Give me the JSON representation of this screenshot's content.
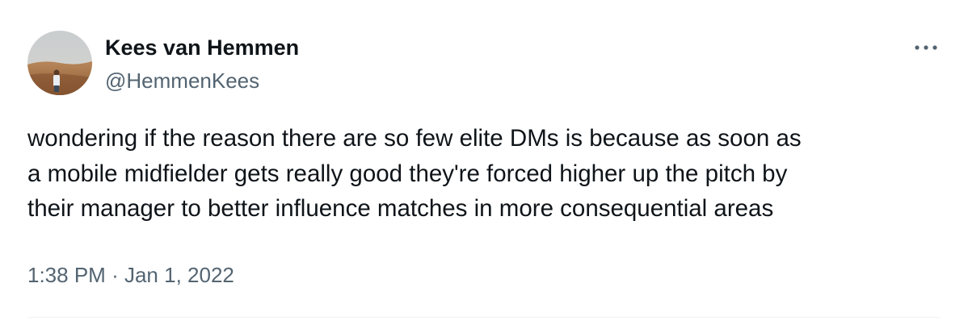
{
  "tweet": {
    "author": {
      "display_name": "Kees van Hemmen",
      "handle": "@HemmenKees"
    },
    "more_icon": "more-horizontal-icon",
    "text": "wondering if the reason there are so few elite DMs is because as soon as\na mobile midfielder gets really good they're forced higher up the pitch by\ntheir manager to better influence matches in more consequential areas",
    "time": "1:38 PM",
    "separator": "·",
    "date": "Jan 1, 2022"
  },
  "colors": {
    "primary_text": "#0f1419",
    "secondary_text": "#536471",
    "divider": "#eff3f4"
  }
}
